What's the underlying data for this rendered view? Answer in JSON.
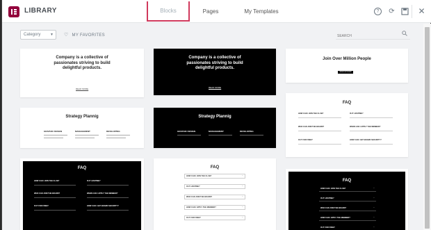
{
  "header": {
    "title": "LIBRARY",
    "tabs": [
      "Blocks",
      "Pages",
      "My Templates"
    ],
    "active_tab": "Blocks",
    "icons": [
      "help-icon",
      "sync-icon",
      "save-icon",
      "close-icon"
    ]
  },
  "filters": {
    "category": "Category",
    "favorites": "MY FAVORITES",
    "search_placeholder": "SEARCH"
  },
  "colors": {
    "brand": "#92003b",
    "active_tab_border": "#d0385c"
  },
  "cards": {
    "company_heading": "Company is a collective of passionates striving to build delightful products.",
    "company_button": "READ MORE",
    "join_heading": "Join Over Million People",
    "join_button": "SIGN UP NOW",
    "strategy_heading": "Strategy Plannig",
    "strategy_cols": [
      "GRAPHIC DESIGN",
      "MANAGEMENT",
      "DEVELOPING"
    ],
    "faq_heading": "FAQ",
    "faq_questions": [
      "HOW CAN I JOIN THE CLUB?",
      "IS IT LIFETIME?",
      "WHO CAN JOIN THE BOARD?",
      "WHEN CAN I APPLY THE MEMBER?",
      "IS IT FOR FREE?",
      "HOW CAN I GET BOARD SECURITY?"
    ],
    "faq_single": [
      "HOW CAN I JOIN THE CLUB?",
      "IS IT LIFETIME?",
      "WHO CAN JOIN THE BOARD?",
      "HOW CAN I APPLY THE MEMBER?",
      "IS IT FOR FREE?"
    ],
    "faq_dark_rows": [
      "HOW CAN I JOIN THE CLUB?",
      "IS IT LIFETIME?",
      "WHO CAN JOIN THE BOARD?",
      "HOW CAN I APPLY THE MEMBER?",
      "IS IT FOR FREE?"
    ]
  }
}
